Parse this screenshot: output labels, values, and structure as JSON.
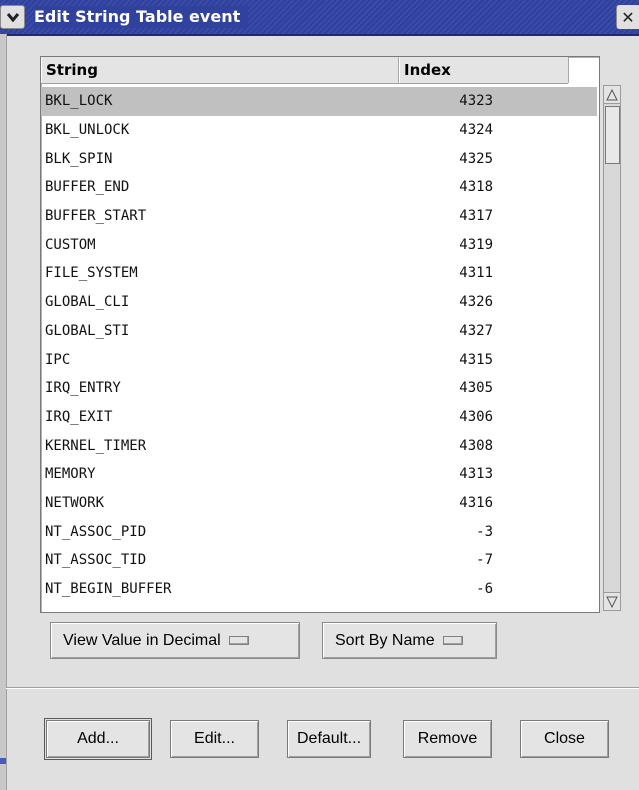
{
  "window": {
    "title": "Edit String Table event",
    "close_glyph": "✕",
    "menu_icon": "chevron-down-icon"
  },
  "list": {
    "columns": {
      "string": "String",
      "index": "Index"
    },
    "rows": [
      {
        "string": "BKL_LOCK",
        "index": "4323",
        "selected": true
      },
      {
        "string": "BKL_UNLOCK",
        "index": "4324"
      },
      {
        "string": "BLK_SPIN",
        "index": "4325"
      },
      {
        "string": "BUFFER_END",
        "index": "4318"
      },
      {
        "string": "BUFFER_START",
        "index": "4317"
      },
      {
        "string": "CUSTOM",
        "index": "4319"
      },
      {
        "string": "FILE_SYSTEM",
        "index": "4311"
      },
      {
        "string": "GLOBAL_CLI",
        "index": "4326"
      },
      {
        "string": "GLOBAL_STI",
        "index": "4327"
      },
      {
        "string": "IPC",
        "index": "4315"
      },
      {
        "string": "IRQ_ENTRY",
        "index": "4305"
      },
      {
        "string": "IRQ_EXIT",
        "index": "4306"
      },
      {
        "string": "KERNEL_TIMER",
        "index": "4308"
      },
      {
        "string": "MEMORY",
        "index": "4313"
      },
      {
        "string": "NETWORK",
        "index": "4316"
      },
      {
        "string": "NT_ASSOC_PID",
        "index": "-3"
      },
      {
        "string": "NT_ASSOC_TID",
        "index": "-7"
      },
      {
        "string": "NT_BEGIN_BUFFER",
        "index": "-6"
      }
    ]
  },
  "options": {
    "view_value": "View Value in Decimal",
    "sort_by": "Sort By Name"
  },
  "buttons": {
    "add": "Add...",
    "edit": "Edit...",
    "default": "Default...",
    "remove": "Remove",
    "close": "Close"
  },
  "colors": {
    "titlebar": "#31419e",
    "selected_row": "#c0c0c0",
    "window_bg": "#e0e0e0"
  }
}
